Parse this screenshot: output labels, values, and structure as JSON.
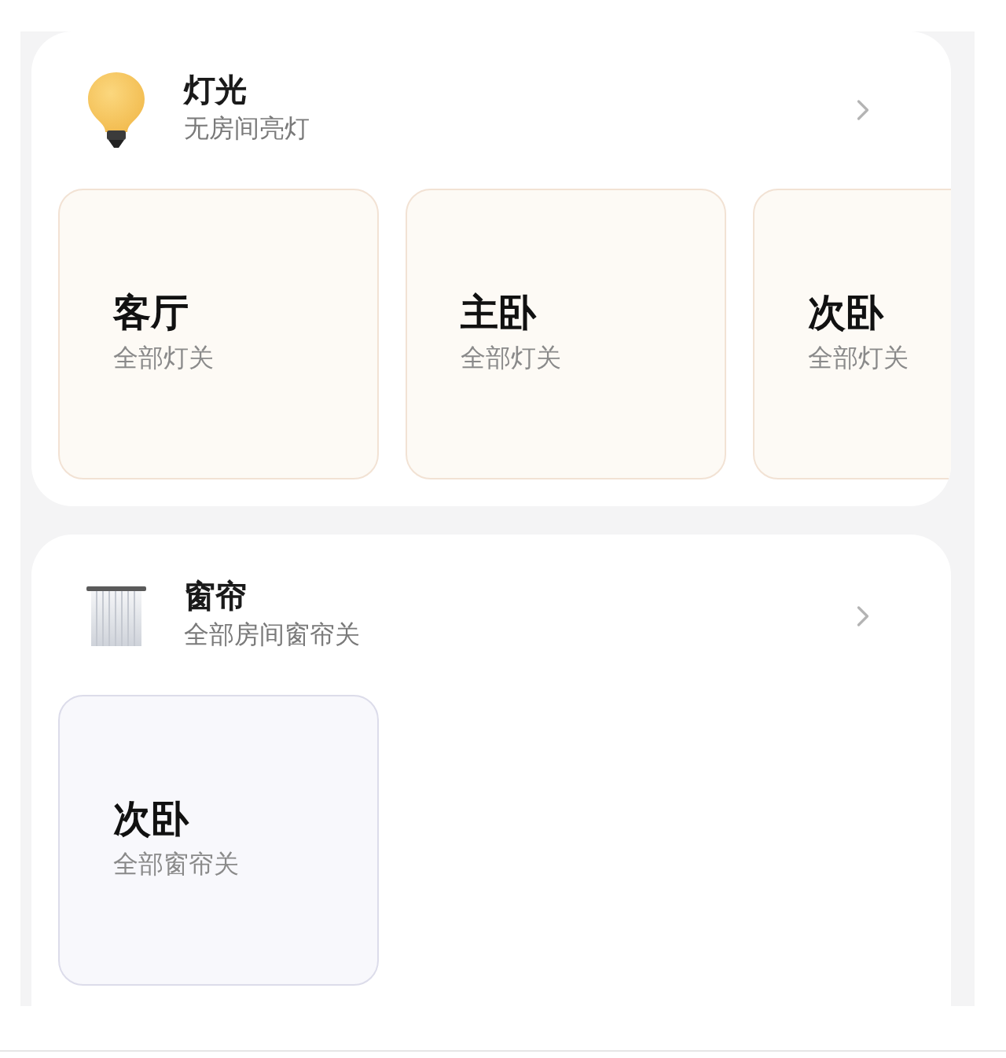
{
  "sections": [
    {
      "kind": "light",
      "title": "灯光",
      "subtitle": "无房间亮灯",
      "rooms": [
        {
          "name": "客厅",
          "status": "全部灯关"
        },
        {
          "name": "主卧",
          "status": "全部灯关"
        },
        {
          "name": "次卧",
          "status": "全部灯关"
        }
      ]
    },
    {
      "kind": "curtain",
      "title": "窗帘",
      "subtitle": "全部房间窗帘关",
      "rooms": [
        {
          "name": "次卧",
          "status": "全部窗帘关"
        }
      ]
    }
  ]
}
